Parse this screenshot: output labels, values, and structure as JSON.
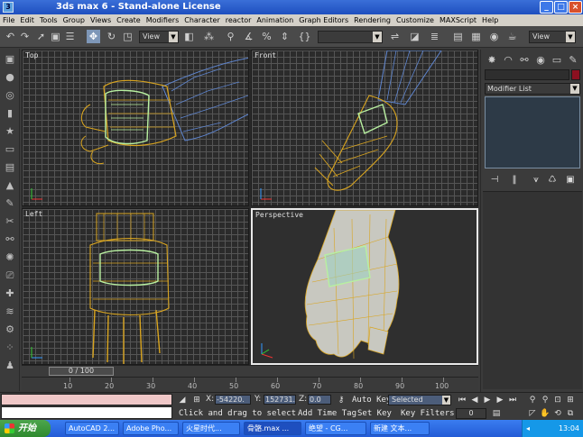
{
  "window": {
    "title": "3ds max 6 - Stand-alone License"
  },
  "menu": [
    "File",
    "Edit",
    "Tools",
    "Group",
    "Views",
    "Create",
    "Modifiers",
    "Character",
    "reactor",
    "Animation",
    "Graph Editors",
    "Rendering",
    "Customize",
    "MAXScript",
    "Help"
  ],
  "toolbar": {
    "view_dropdown": "View",
    "view_dropdown_right": "View"
  },
  "viewports": {
    "top": "Top",
    "front": "Front",
    "left": "Left",
    "perspective": "Perspective"
  },
  "command_panel": {
    "modifier_list": "Modifier List"
  },
  "timeline": {
    "frame_counter": "0 / 100",
    "ticks": [
      "10",
      "20",
      "30",
      "40",
      "50",
      "60",
      "70",
      "80",
      "90",
      "100"
    ]
  },
  "status": {
    "x_label": "X:",
    "x_value": "-54220.",
    "y_label": "Y:",
    "y_value": "152731.",
    "z_label": "Z:",
    "z_value": "0.0",
    "prompt": "Click and drag to select",
    "add_time_tag": "Add Time Tag",
    "auto_key": "Auto Key",
    "set_key": "Set Key",
    "key_filters": "Key Filters...",
    "selected": "Selected",
    "frame_field": "0"
  },
  "taskbar": {
    "start": "开始",
    "tasks": [
      "AutoCAD 2...",
      "Adobe Pho...",
      "火星时代...",
      "骨骼.max ...",
      "绝望 - CG...",
      "新建 文本..."
    ],
    "clock": "13:04"
  },
  "colors": {
    "accent": "#7e97b8",
    "wire_yellow": "#d9a520",
    "wire_green": "#b8f0a0",
    "wire_blue": "#5f86d0",
    "object_color": "#8c1020"
  }
}
